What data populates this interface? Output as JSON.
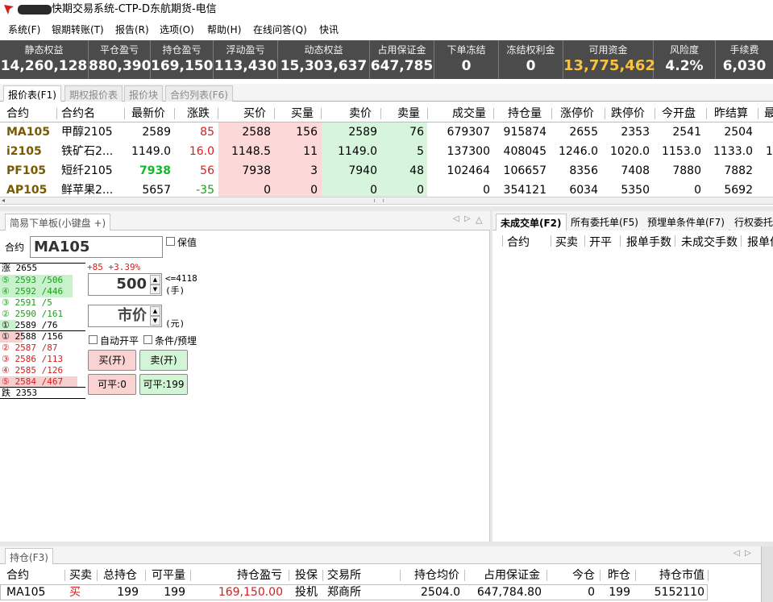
{
  "window": {
    "title": "快期交易系统-CTP-D东航期货-电信"
  },
  "menu": [
    "系统(F)",
    "银期转账(T)",
    "报告(R)",
    "选项(O)",
    "帮助(H)",
    "在线问答(Q)",
    "快讯"
  ],
  "account": [
    {
      "label": "静态权益",
      "value": "14,260,128"
    },
    {
      "label": "平仓盈亏",
      "value": "880,390"
    },
    {
      "label": "持仓盈亏",
      "value": "169,150"
    },
    {
      "label": "浮动盈亏",
      "value": "113,430"
    },
    {
      "label": "动态权益",
      "value": "15,303,637"
    },
    {
      "label": "占用保证金",
      "value": "647,785"
    },
    {
      "label": "下单冻结",
      "value": "0"
    },
    {
      "label": "冻结权利金",
      "value": "0"
    },
    {
      "label": "可用资金",
      "value": "13,775,462"
    },
    {
      "label": "风险度",
      "value": "4.2%"
    },
    {
      "label": "手续费",
      "value": "6,030"
    }
  ],
  "quote_tabs": [
    "报价表(F1)",
    "期权报价表",
    "报价块",
    "合约列表(F6)"
  ],
  "quote_headers": [
    "合约",
    "合约名",
    "最新价",
    "涨跌",
    "买价",
    "买量",
    "卖价",
    "卖量",
    "成交量",
    "持仓量",
    "涨停价",
    "跌停价",
    "今开盘",
    "昨结算",
    "最"
  ],
  "quotes": [
    [
      "MA105",
      "甲醇2105",
      "2589",
      "85",
      "2588",
      "156",
      "2589",
      "76",
      "679307",
      "915874",
      "2655",
      "2353",
      "2541",
      "2504",
      ""
    ],
    [
      "i2105",
      "铁矿石2...",
      "1149.0",
      "16.0",
      "1148.5",
      "11",
      "1149.0",
      "5",
      "137300",
      "408045",
      "1246.0",
      "1020.0",
      "1153.0",
      "1133.0",
      "1"
    ],
    [
      "PF105",
      "短纤2105",
      "7938",
      "56",
      "7938",
      "3",
      "7940",
      "48",
      "102464",
      "106657",
      "8356",
      "7408",
      "7880",
      "7882",
      ""
    ],
    [
      "AP105",
      "鲜苹果2...",
      "5657",
      "-35",
      "0",
      "0",
      "0",
      "0",
      "0",
      "354121",
      "6034",
      "5350",
      "0",
      "5692",
      ""
    ]
  ],
  "order_panel": {
    "tab": "简易下单板(小键盘 +)",
    "contract_label": "合约",
    "contract": "MA105",
    "hedge_label": "保值",
    "change": "+85 +3.39%",
    "limit_up": "涨 2655",
    "limit_down": "跌 2353",
    "asks": [
      "⑤ 2593 /506",
      "④ 2592 /446",
      "③ 2591 /5",
      "② 2590 /161",
      "① 2589 /76"
    ],
    "bids": [
      "① 2588 /156",
      "② 2587 /87",
      "③ 2586 /113",
      "④ 2585 /126",
      "⑤ 2584 /467"
    ],
    "qty": "500",
    "qty_limit": "<=4118",
    "qty_unit": "(手)",
    "price": "市价",
    "price_unit": "(元)",
    "auto_label": "自动开平",
    "cond_label": "条件/预埋",
    "buy": "买(开)",
    "sell": "卖(开)",
    "close_buy": "可平:0",
    "close_sell": "可平:199"
  },
  "right_panel": {
    "tabs": [
      "未成交单(F2)",
      "所有委托单(F5)",
      "预埋单条件单(F7)",
      "行权委托"
    ],
    "headers": [
      "合约",
      "买卖",
      "开平",
      "报单手数",
      "未成交手数",
      "报单价"
    ]
  },
  "positions": {
    "tab": "持仓(F3)",
    "headers": [
      "合约",
      "买卖",
      "总持仓",
      "可平量",
      "持仓盈亏",
      "投保",
      "交易所",
      "持仓均价",
      "占用保证金",
      "今仓",
      "昨仓",
      "持仓市值"
    ],
    "rows": [
      [
        "MA105",
        "买",
        "199",
        "199",
        "169,150.00",
        "投机",
        "郑商所",
        "2504.0",
        "647,784.80",
        "0",
        "199",
        "5152110"
      ]
    ]
  },
  "colors": {
    "account_bg": "#4b4b4b",
    "highlight": "#f6c343",
    "up": "#d02020",
    "down": "#18a018"
  }
}
